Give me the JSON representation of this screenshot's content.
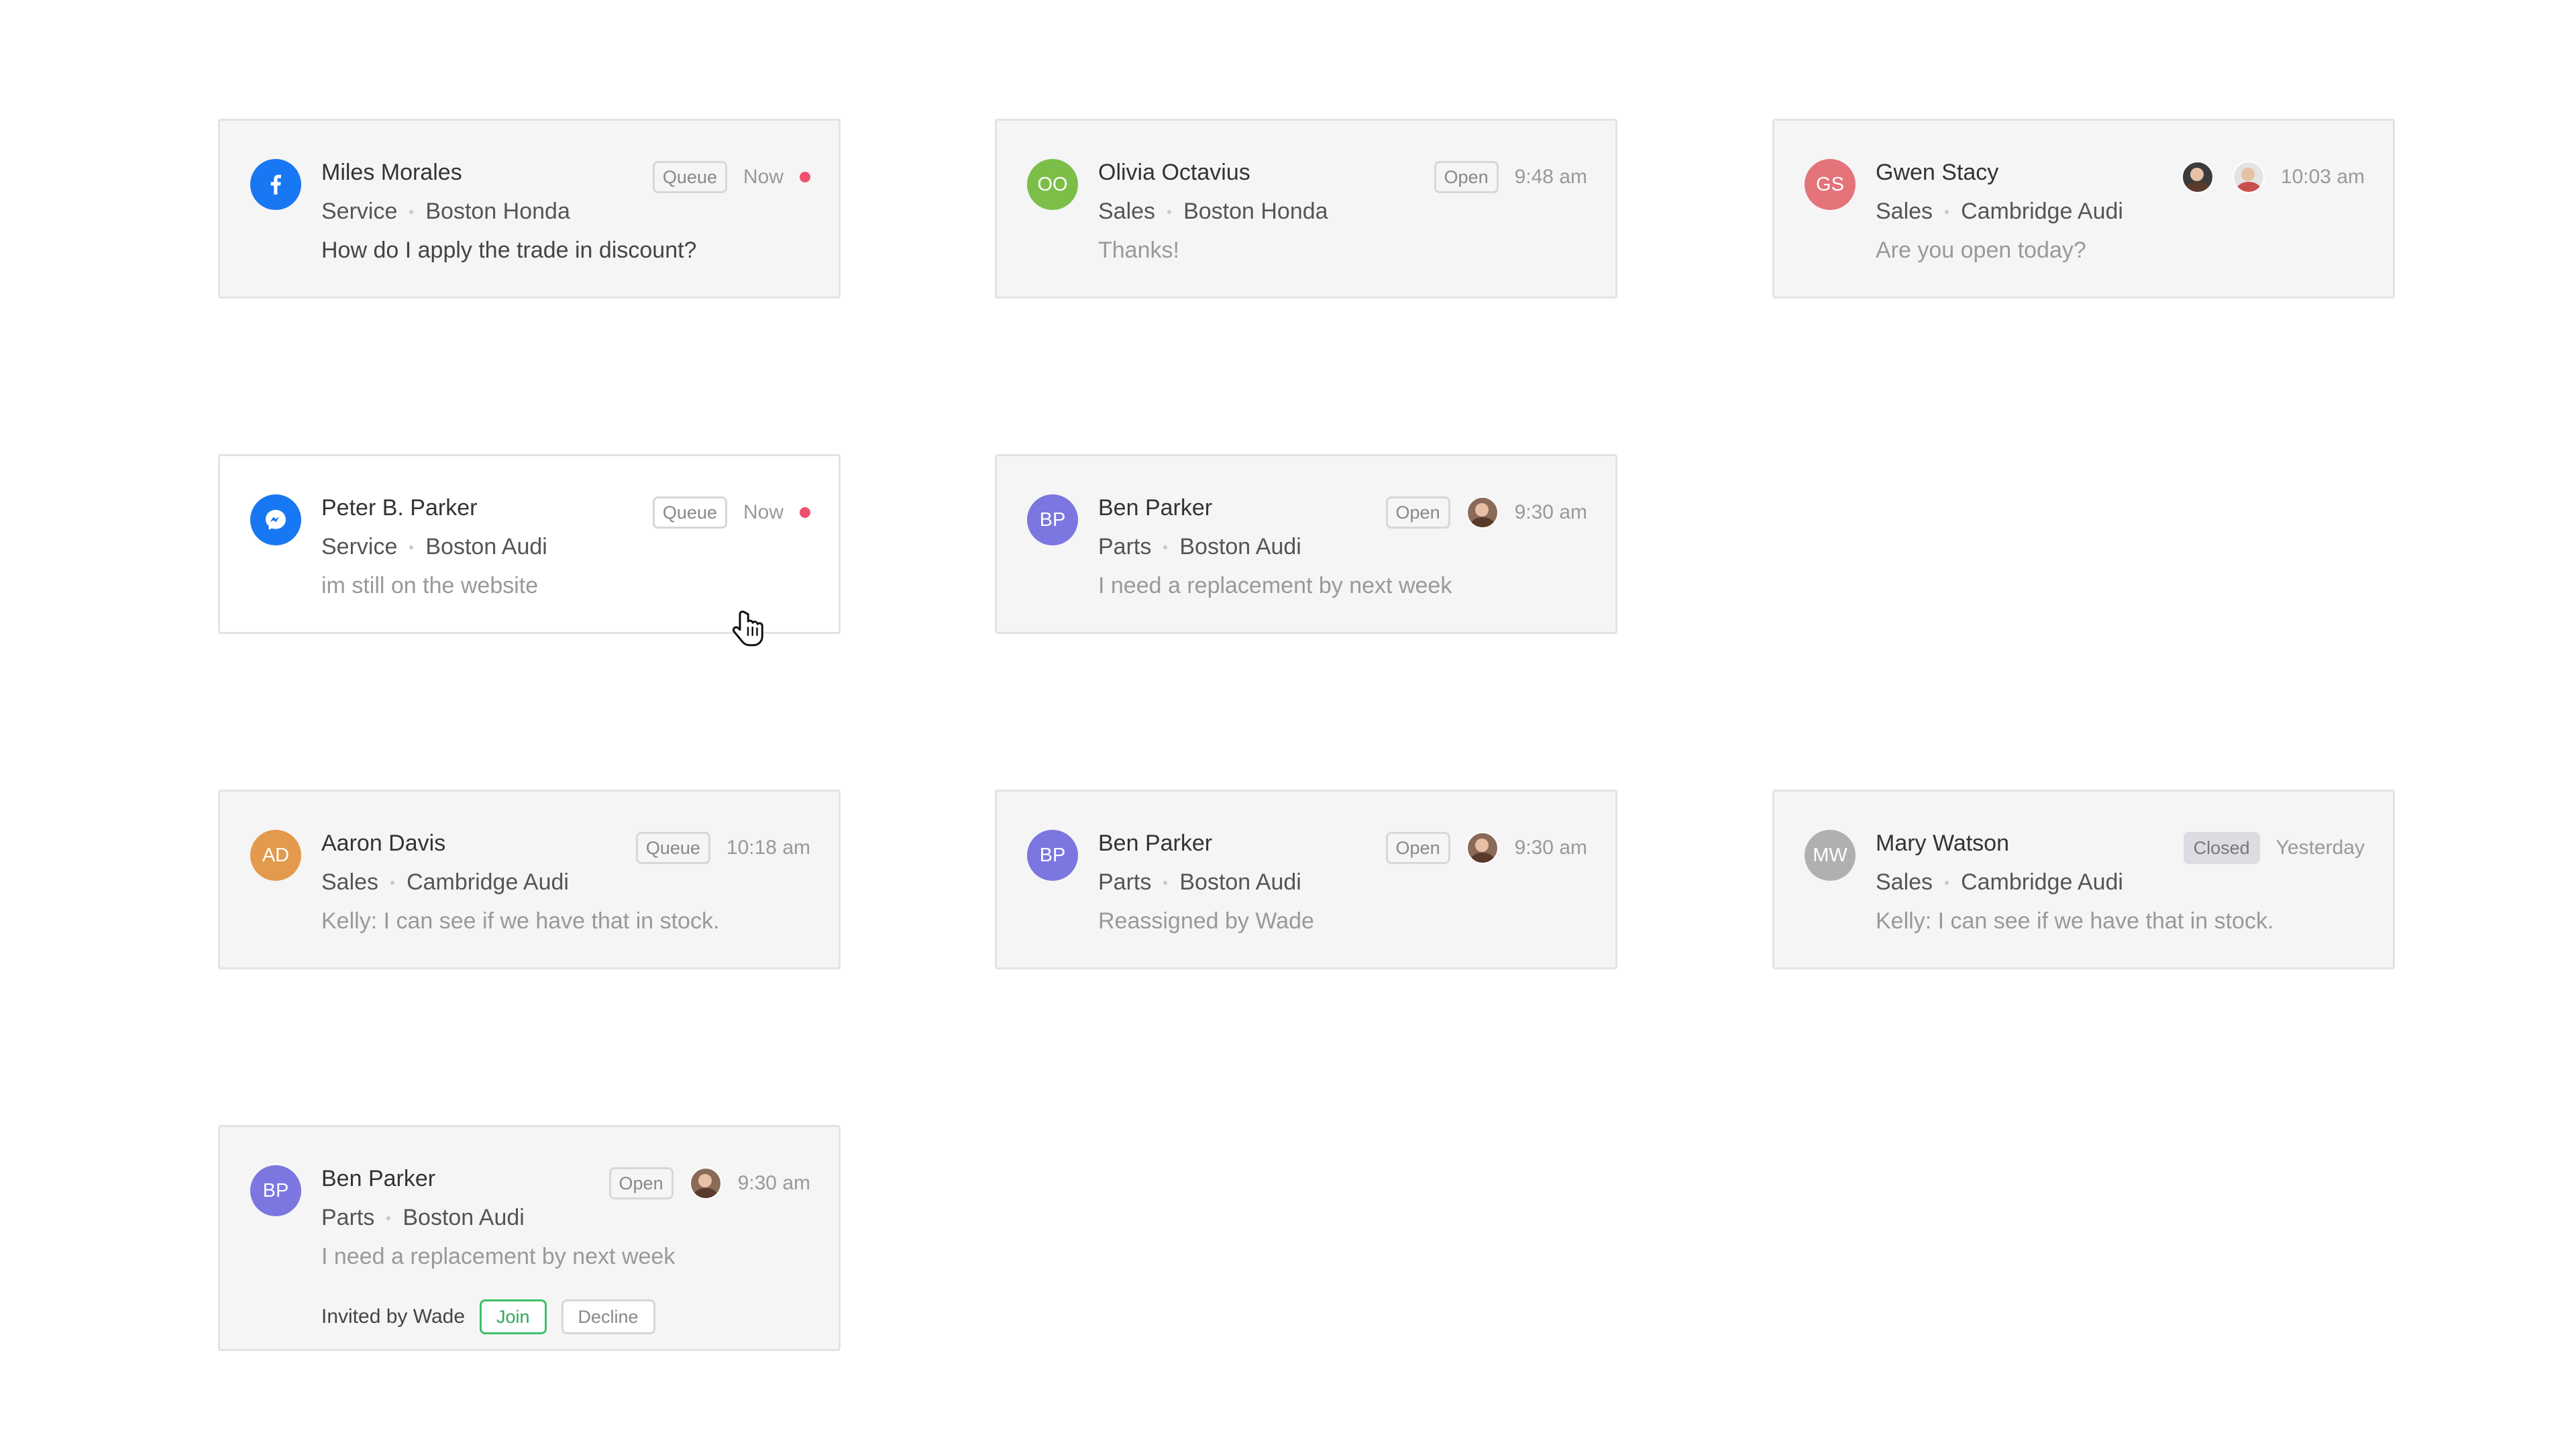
{
  "colors": {
    "facebook": "#1877f2",
    "messenger": "#1877f2",
    "oo": "#7cbf48",
    "gs": "#e4737a",
    "bp": "#7b76e0",
    "ad": "#e39a4c",
    "mw": "#b0b0b0",
    "unread": "#f0506e",
    "join": "#3ec06a"
  },
  "cards": [
    {
      "avatar_icon": "facebook-icon",
      "name": "Miles Morales",
      "department": "Service",
      "location": "Boston Honda",
      "message": "How do I apply the trade in discount?",
      "status": "Queue",
      "time": "Now",
      "unread": true
    },
    {
      "avatar_initials": "OO",
      "name": "Olivia Octavius",
      "department": "Sales",
      "location": "Boston Honda",
      "message": "Thanks!",
      "status": "Open",
      "time": "9:48 am"
    },
    {
      "avatar_initials": "GS",
      "name": "Gwen Stacy",
      "department": "Sales",
      "location": "Cambridge Audi",
      "message": "Are you open today?",
      "time": "10:03 am",
      "agents": 2
    },
    {
      "avatar_icon": "messenger-icon",
      "name": "Peter B. Parker",
      "department": "Service",
      "location": "Boston Audi",
      "message": "im still on the website",
      "status": "Queue",
      "time": "Now",
      "unread": true
    },
    {
      "avatar_initials": "BP",
      "name": "Ben Parker",
      "department": "Parts",
      "location": "Boston Audi",
      "message": "I need a replacement by next week",
      "status": "Open",
      "time": "9:30 am",
      "agents": 1
    },
    {
      "avatar_initials": "AD",
      "name": "Aaron Davis",
      "department": "Sales",
      "location": "Cambridge Audi",
      "message": "Kelly: I can see if we have that in stock.",
      "status": "Queue",
      "time": "10:18 am"
    },
    {
      "avatar_initials": "BP",
      "name": "Ben Parker",
      "department": "Parts",
      "location": "Boston Audi",
      "message": "Reassigned by Wade",
      "status": "Open",
      "time": "9:30 am",
      "agents": 1
    },
    {
      "avatar_initials": "MW",
      "name": "Mary Watson",
      "department": "Sales",
      "location": "Cambridge Audi",
      "message": "Kelly: I can see if we have that in stock.",
      "status": "Closed",
      "time": "Yesterday"
    },
    {
      "avatar_initials": "BP",
      "name": "Ben Parker",
      "department": "Parts",
      "location": "Boston Audi",
      "message": "I need a replacement by next week",
      "status": "Open",
      "time": "9:30 am",
      "agents": 1,
      "invite": {
        "text": "Invited by Wade",
        "join_label": "Join",
        "decline_label": "Decline"
      }
    }
  ]
}
